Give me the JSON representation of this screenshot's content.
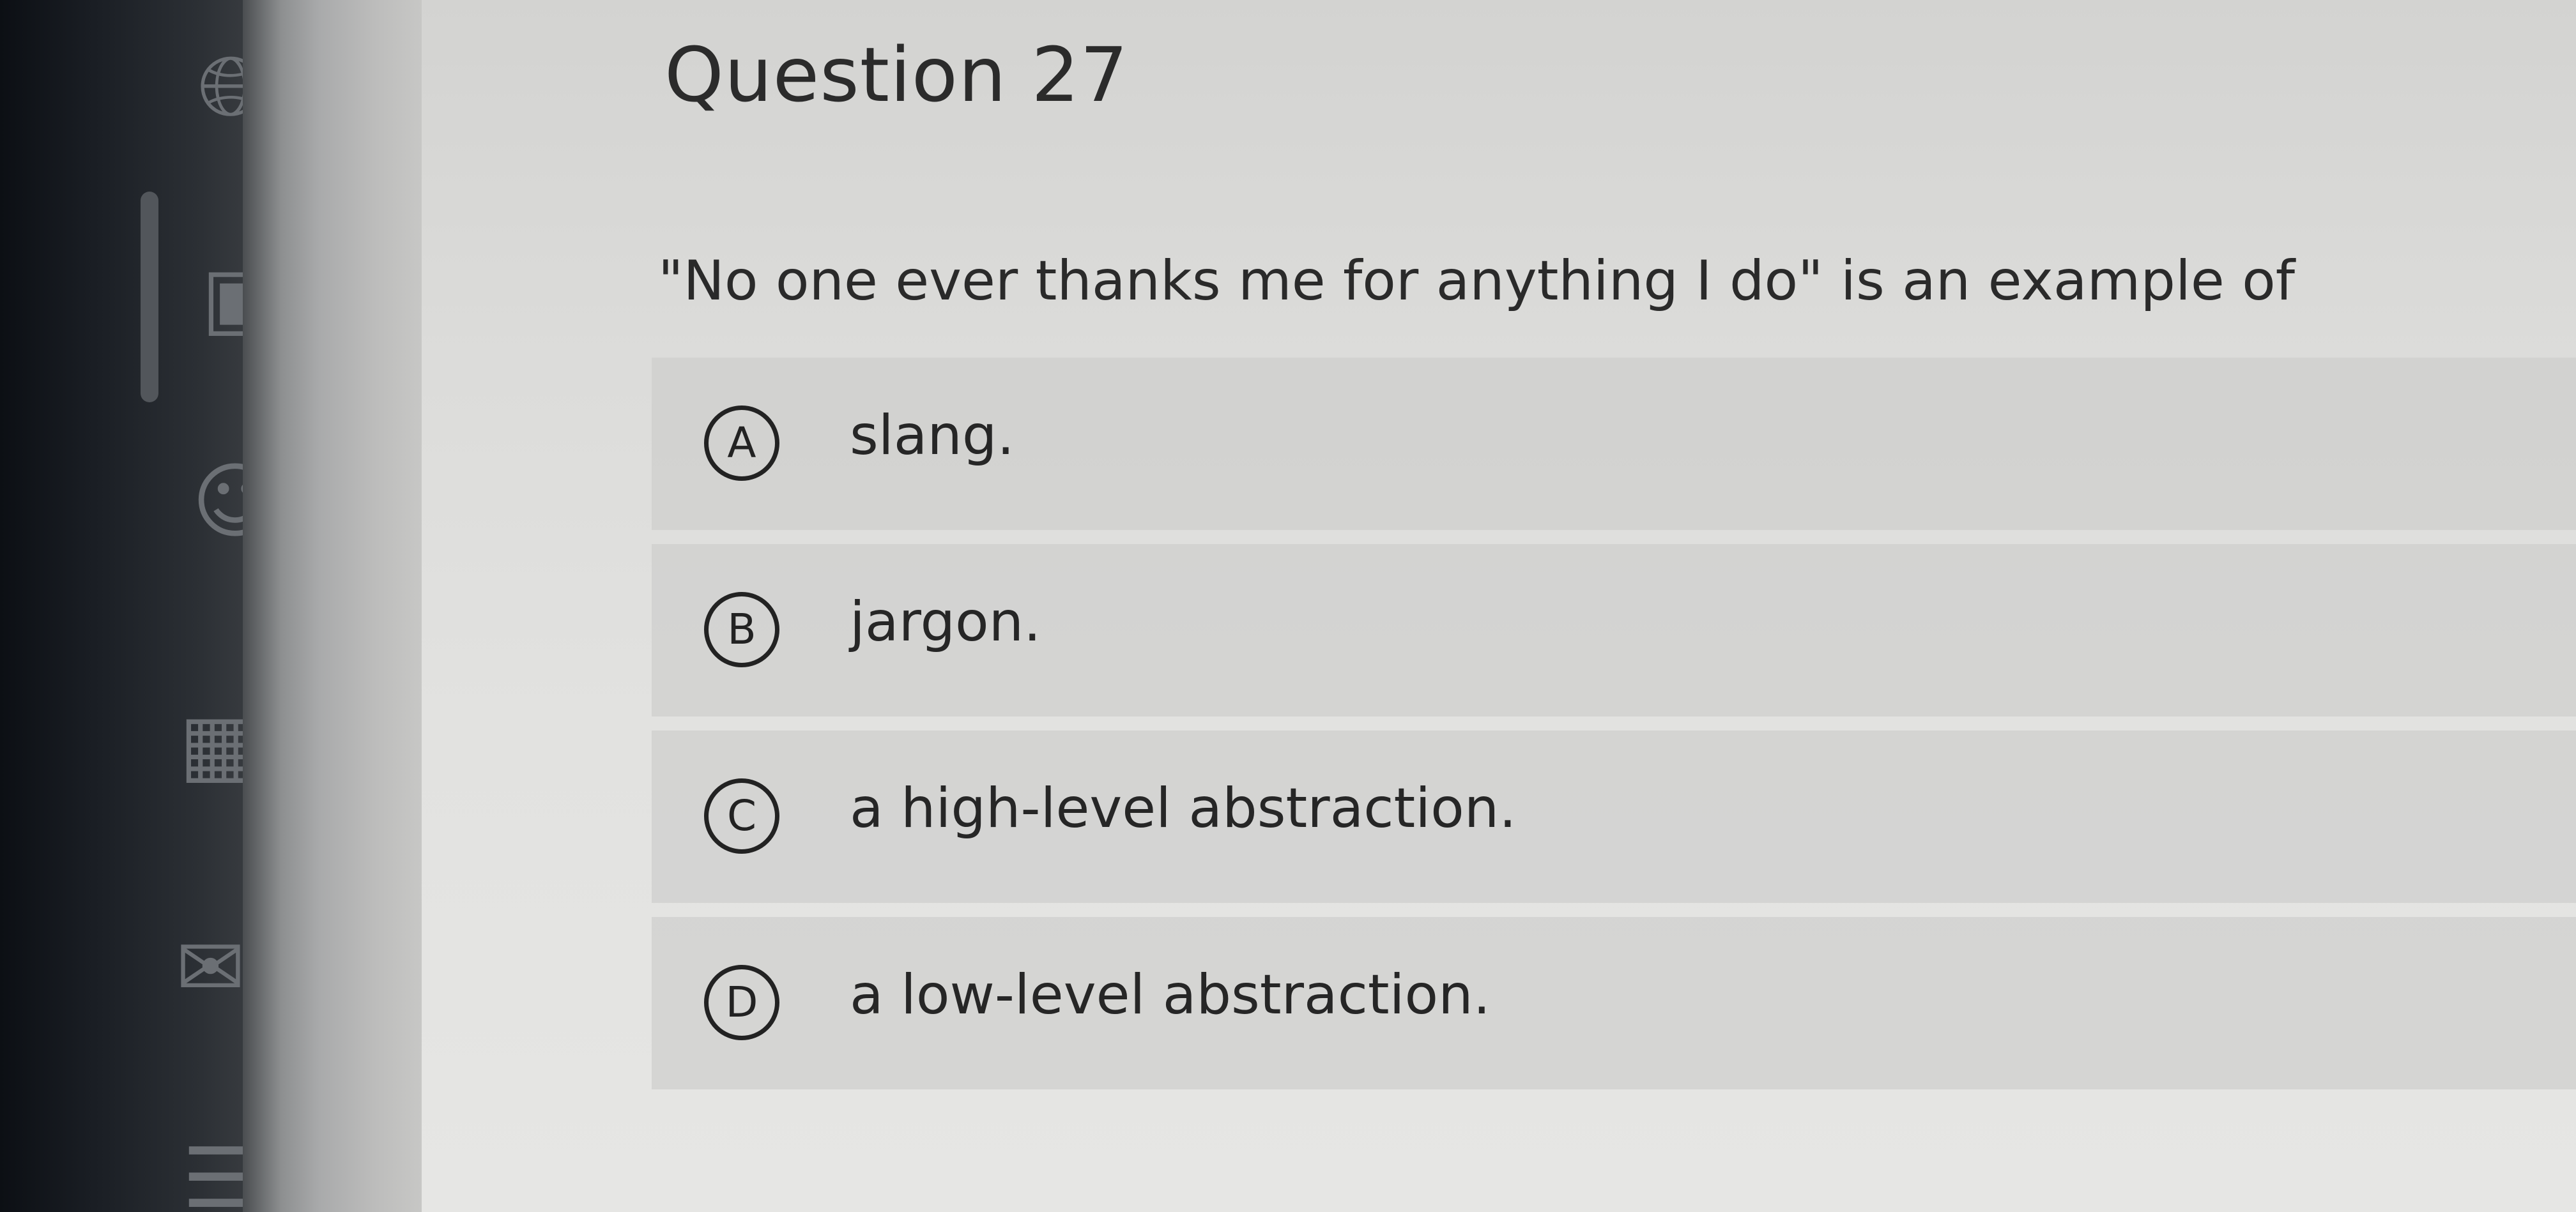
{
  "question": {
    "title": "Question 27",
    "prompt": "\"No one ever thanks me for anything I do\" is an example of"
  },
  "options": [
    {
      "letter": "A",
      "text": "slang."
    },
    {
      "letter": "B",
      "text": "jargon."
    },
    {
      "letter": "C",
      "text": "a high-level abstraction."
    },
    {
      "letter": "D",
      "text": "a low-level abstraction."
    }
  ],
  "nav": {
    "icons": [
      "globe-icon",
      "book-icon",
      "people-icon",
      "calendar-icon",
      "mail-icon",
      "list-icon"
    ]
  }
}
